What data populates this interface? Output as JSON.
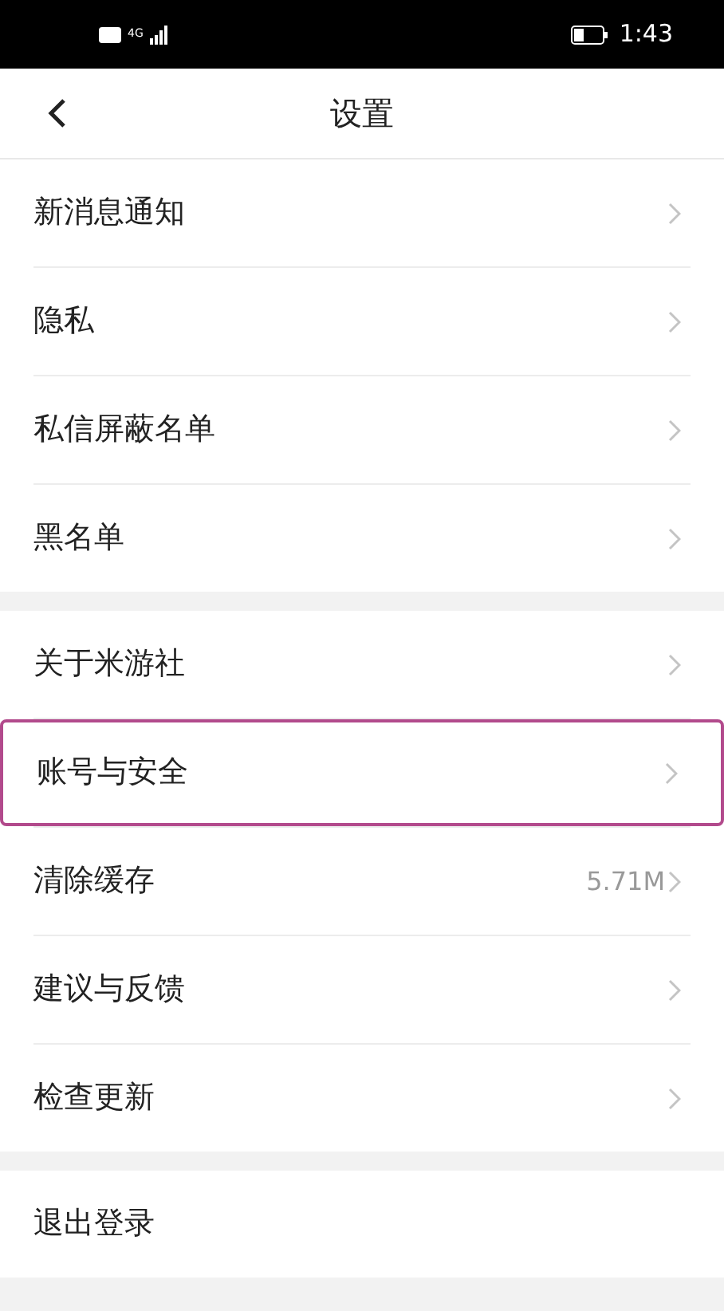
{
  "status_bar": {
    "network": "4G",
    "time": "1:43"
  },
  "header": {
    "title": "设置"
  },
  "groups": [
    {
      "items": [
        {
          "label": "新消息通知",
          "highlighted": false
        },
        {
          "label": "隐私",
          "highlighted": false
        },
        {
          "label": "私信屏蔽名单",
          "highlighted": false
        },
        {
          "label": "黑名单",
          "highlighted": false
        }
      ]
    },
    {
      "items": [
        {
          "label": "关于米游社",
          "highlighted": false
        },
        {
          "label": "账号与安全",
          "highlighted": true
        },
        {
          "label": "清除缓存",
          "value": "5.71M",
          "highlighted": false
        },
        {
          "label": "建议与反馈",
          "highlighted": false
        },
        {
          "label": "检查更新",
          "highlighted": false
        }
      ]
    }
  ],
  "logout": {
    "label": "退出登录"
  }
}
